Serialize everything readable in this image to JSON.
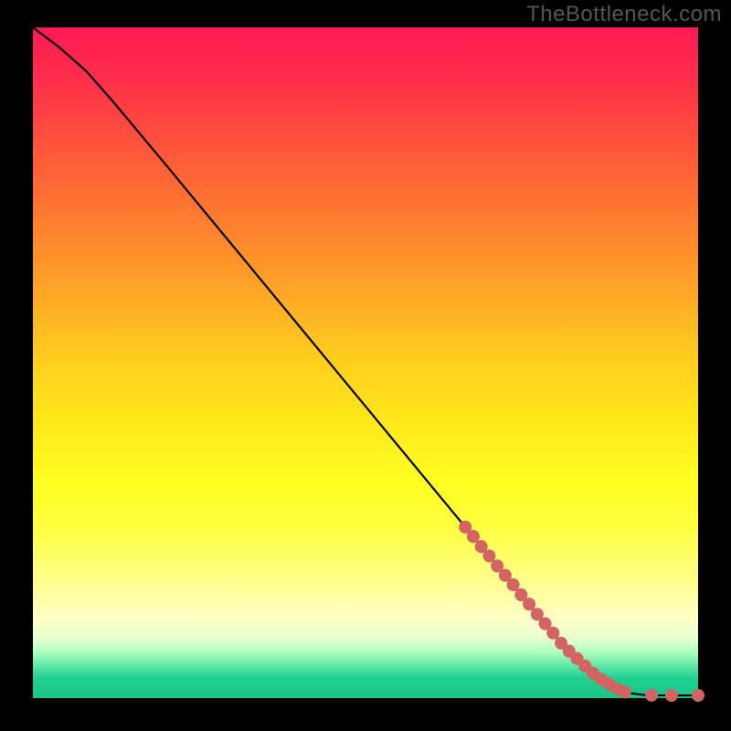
{
  "attribution": "TheBottleneck.com",
  "colors": {
    "dot": "#d46464",
    "curve": "#000000"
  },
  "chart_data": {
    "type": "line",
    "title": "",
    "xlabel": "",
    "ylabel": "",
    "xlim": [
      0,
      100
    ],
    "ylim": [
      0,
      100
    ],
    "grid": false,
    "legend": false,
    "series": [
      {
        "name": "curve",
        "x": [
          0,
          4,
          8,
          12,
          20,
          30,
          40,
          50,
          60,
          65,
          70,
          75,
          80,
          85,
          90,
          92,
          94,
          96,
          98,
          100
        ],
        "y": [
          100,
          97,
          93.5,
          89,
          79.5,
          67.5,
          55.5,
          43.5,
          31.5,
          25.5,
          19.5,
          13.5,
          7.5,
          3.0,
          0.7,
          0.45,
          0.4,
          0.4,
          0.4,
          0.4
        ]
      }
    ],
    "points_on_curve": [
      {
        "x": 65.0,
        "y": 25.5
      },
      {
        "x": 66.2,
        "y": 24.1
      },
      {
        "x": 67.4,
        "y": 22.6
      },
      {
        "x": 68.6,
        "y": 21.2
      },
      {
        "x": 69.8,
        "y": 19.7
      },
      {
        "x": 71.0,
        "y": 18.3
      },
      {
        "x": 72.2,
        "y": 16.9
      },
      {
        "x": 73.4,
        "y": 15.4
      },
      {
        "x": 74.6,
        "y": 14.0
      },
      {
        "x": 75.8,
        "y": 12.5
      },
      {
        "x": 77.0,
        "y": 11.1
      },
      {
        "x": 78.2,
        "y": 9.7
      },
      {
        "x": 79.4,
        "y": 8.2
      },
      {
        "x": 80.6,
        "y": 7.0
      },
      {
        "x": 81.8,
        "y": 5.9
      },
      {
        "x": 83.0,
        "y": 4.8
      },
      {
        "x": 84.2,
        "y": 3.7
      },
      {
        "x": 85.4,
        "y": 2.8
      },
      {
        "x": 86.6,
        "y": 2.1
      },
      {
        "x": 87.8,
        "y": 1.4
      },
      {
        "x": 89.0,
        "y": 0.9
      },
      {
        "x": 93.0,
        "y": 0.42
      },
      {
        "x": 96.0,
        "y": 0.4
      },
      {
        "x": 100.0,
        "y": 0.4
      }
    ],
    "dot_radius": 7
  }
}
